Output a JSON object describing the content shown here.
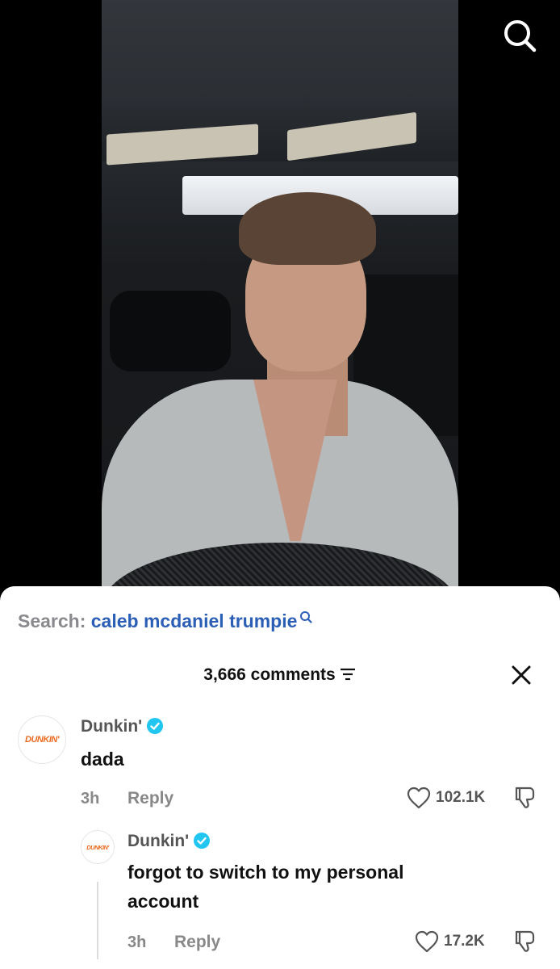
{
  "search": {
    "prefix": "Search:",
    "query": "caleb mcdaniel trumpie"
  },
  "comments_header": {
    "count_label": "3,666 comments"
  },
  "comments": [
    {
      "avatar_text": "DUNKIN'",
      "username": "Dunkin'",
      "verified": true,
      "text": "dada",
      "time": "3h",
      "reply_label": "Reply",
      "likes": "102.1K"
    },
    {
      "avatar_text": "DUNKIN'",
      "username": "Dunkin'",
      "verified": true,
      "text": "forgot to switch to my personal account",
      "time": "3h",
      "reply_label": "Reply",
      "likes": "17.2K"
    }
  ],
  "colors": {
    "search_query": "#2b5fb5",
    "verified_badge": "#20c5f0",
    "brand_orange": "#ea6a1f"
  },
  "icons": [
    "search-icon",
    "filter-icon",
    "close-icon",
    "verified-icon",
    "heart-icon",
    "dislike-icon"
  ]
}
